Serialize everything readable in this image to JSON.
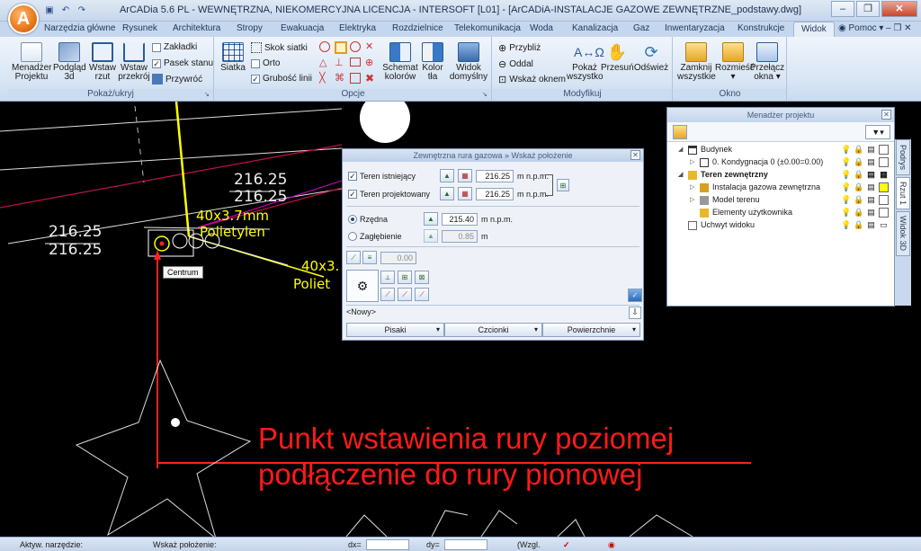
{
  "app": {
    "logo": "A",
    "title": "ArCADia 5.6 PL - WEWNĘTRZNA, NIEKOMERCYJNA LICENCJA - INTERSOFT [L01] - [ArCADiA-INSTALACJE GAZOWE ZEWNĘTRZNE_podstawy.dwg]",
    "qat": [
      "save-icon",
      "undo-icon",
      "redo-icon"
    ],
    "window_controls": [
      "–",
      "❐",
      "✕"
    ]
  },
  "tabs": {
    "items": [
      "Narzędzia główne",
      "Rysunek",
      "Architektura",
      "Stropy",
      "Ewakuacja",
      "Elektryka",
      "Rozdzielnice",
      "Telekomunikacja",
      "Woda",
      "Kanalizacja",
      "Gaz",
      "Inwentaryzacja",
      "Konstrukcje",
      "Widok"
    ],
    "active": "Widok",
    "help": "Pomoc",
    "mdi": "–  ❐  ✕"
  },
  "ribbon": {
    "pokaz": {
      "label": "Pokaż/ukryj",
      "menedzer": "Menadżer\nProjektu",
      "podglad": "Podgląd\n3d",
      "wstaw_rzut": "Wstaw\nrzut",
      "wstaw_przekroj": "Wstaw\nprzekrój",
      "zakladki": "Zakładki",
      "pasek_stanu": "Pasek stanu",
      "przywroc": "Przywróć"
    },
    "opcje": {
      "label": "Opcje",
      "siatka": "Siatka",
      "skok_siatki": "Skok siatki",
      "orto": "Orto",
      "grubosc": "Grubość linii",
      "schemat": "Schemat\nkolorów",
      "kolor_tla": "Kolor\ntła",
      "widok_domyslny": "Widok\ndomyślny"
    },
    "modyfikuj": {
      "label": "Modyfikuj",
      "przybliz": "Przybliż",
      "oddal": "Oddal",
      "wskaz_oknem": "Wskaż oknem",
      "pokaz_wszystko": "Pokaż\nwszystko",
      "przesun": "Przesuń",
      "odswiez": "Odśwież"
    },
    "okno": {
      "label": "Okno",
      "zamknij": "Zamknij\nwszystkie",
      "rozmiesc": "Rozmieść\n▾",
      "przelacz": "Przełącz\nokna ▾"
    }
  },
  "canvas": {
    "elev_labels": [
      "216.25",
      "216.25",
      "216.25",
      "216.25"
    ],
    "pipe_label_1": "40x3.7mm",
    "pipe_label_1b": "Polietylen",
    "pipe_label_2": "40x3.",
    "pipe_label_2b": "Poliet",
    "tooltip": "Centrum",
    "annotation_line1": "Punkt wstawienia rury poziomej",
    "annotation_line2": "podłączenie do rury pionowej"
  },
  "dialog": {
    "title": "Zewnętrzna rura gazowa » Wskaż położenie",
    "teren_istniejacy": "Teren istniejący",
    "teren_istniejacy_value": "216.25",
    "teren_projektowany": "Teren projektowany",
    "teren_projektowany_value": "216.25",
    "unit": "m n.p.m.",
    "rzedna": "Rzędna",
    "rzedna_value": "215.40",
    "zaglebienie": "Zagłębienie",
    "zaglebienie_value": "0.85",
    "m": "m",
    "slope_value": "0.00",
    "style": "<Nowy>",
    "btn_pisaki": "Pisaki",
    "btn_czcionki": "Czcionki",
    "btn_powierzchnie": "Powierzchnie",
    "arrow": "▾"
  },
  "project_manager": {
    "title": "Menadżer projektu",
    "items": [
      {
        "label": "Budynek",
        "expander": "◢"
      },
      {
        "label": "0. Kondygnacja 0 (±0.00=0.00)",
        "expander": "▷"
      },
      {
        "label": "Teren zewnętrzny",
        "expander": "◢"
      },
      {
        "label": "Instalacja gazowa zewnętrzna",
        "expander": "▷"
      },
      {
        "label": "Model terenu",
        "expander": "▷"
      },
      {
        "label": "Elementy użytkownika",
        "expander": ""
      },
      {
        "label": "Uchwyt widoku",
        "expander": ""
      }
    ],
    "side_tabs": [
      "Podrys",
      "Rzut 1",
      "Widok 3D"
    ],
    "colors": {
      "yellow": "#ffff00",
      "white": "#ffffff"
    }
  },
  "status": {
    "aktywne": "Aktyw. narzędzie:",
    "wskaz": "Wskaż położenie:",
    "dx": "dx=",
    "dy": "dy=",
    "wzgl": "Wzgl."
  }
}
